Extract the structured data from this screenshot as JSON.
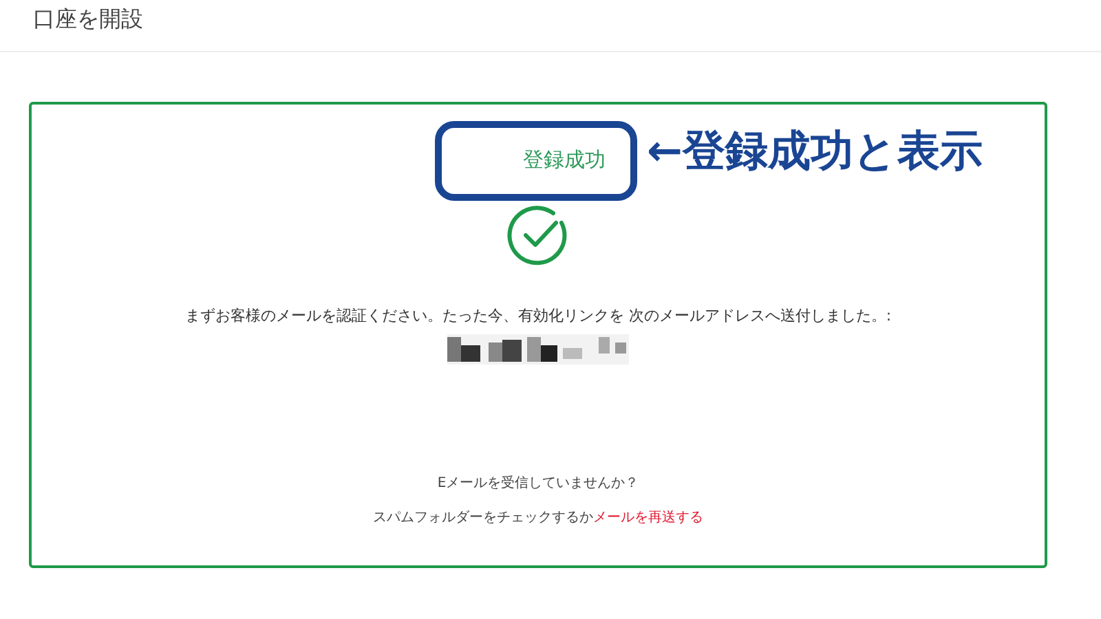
{
  "header": {
    "title": "口座を開設"
  },
  "card": {
    "status": "登録成功",
    "success": true,
    "message": "まずお客様のメールを認証ください。たった今、有効化リンクを 次のメールアドレスへ送付しました。:",
    "not_received": "Eメールを受信していませんか？",
    "spam_hint": "スパムフォルダーをチェックするか",
    "resend_link": "メールを再送する"
  },
  "annotation": {
    "label": "←登録成功と表示"
  }
}
